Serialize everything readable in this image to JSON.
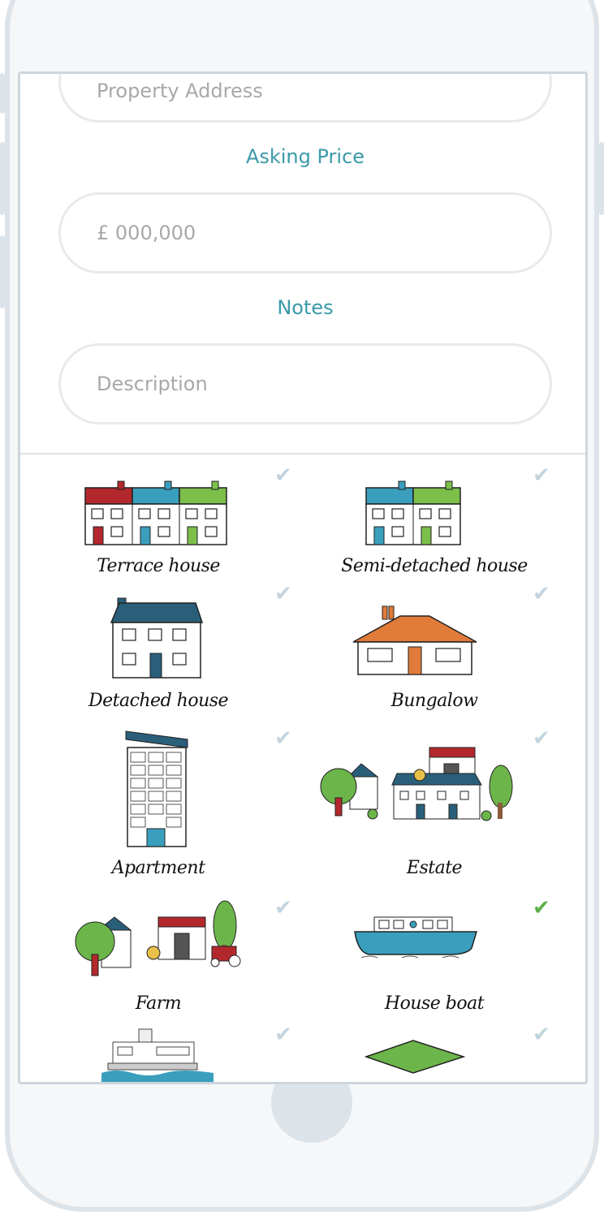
{
  "form": {
    "address_placeholder": "Property Address",
    "asking_price_label": "Asking Price",
    "price_placeholder": "£ 000,000",
    "notes_label": "Notes",
    "description_placeholder": "Description"
  },
  "property_types": [
    {
      "label": "Terrace house",
      "icon": "terrace-house-icon",
      "selected": false
    },
    {
      "label": "Semi-detached house",
      "icon": "semi-detached-house-icon",
      "selected": false
    },
    {
      "label": "Detached house",
      "icon": "detached-house-icon",
      "selected": false
    },
    {
      "label": "Bungalow",
      "icon": "bungalow-icon",
      "selected": false
    },
    {
      "label": "Apartment",
      "icon": "apartment-icon",
      "selected": false
    },
    {
      "label": "Estate",
      "icon": "estate-icon",
      "selected": false
    },
    {
      "label": "Farm",
      "icon": "farm-icon",
      "selected": false
    },
    {
      "label": "House boat",
      "icon": "house-boat-icon",
      "selected": true
    },
    {
      "label": "",
      "icon": "waterfront-building-icon",
      "selected": false
    },
    {
      "label": "",
      "icon": "land-plot-icon",
      "selected": false
    }
  ],
  "colors": {
    "accent": "#3a9aa8",
    "check_selected": "#5db04a",
    "check_unselected": "#c4d4de",
    "red": "#b3282d",
    "teal": "#3a9fbd",
    "green": "#7cbf4a",
    "navy": "#2a5f7a",
    "orange": "#e07b39"
  },
  "icons": {
    "check": "✔"
  }
}
